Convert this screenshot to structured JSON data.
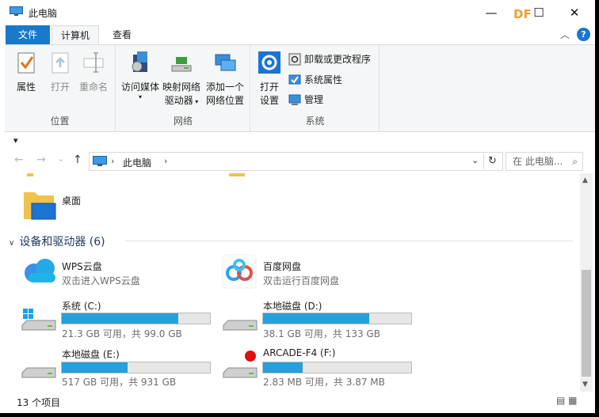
{
  "window": {
    "title": "此电脑",
    "minimize": "—",
    "maximize": "☐",
    "close": "✕",
    "watermark": "DF"
  },
  "ribbon_tabs": {
    "file": "文件",
    "computer": "计算机",
    "view": "查看",
    "collapse": "︿",
    "help": "?"
  },
  "ribbon": {
    "location": {
      "label": "位置",
      "properties": "属性",
      "open": "打开",
      "rename": "重命名"
    },
    "network": {
      "label": "网络",
      "access_media": "访问媒体",
      "map_drive_1": "映射网络",
      "map_drive_2": "驱动器",
      "add_location_1": "添加一个",
      "add_location_2": "网络位置"
    },
    "system": {
      "label": "系统",
      "open_settings_1": "打开",
      "open_settings_2": "设置",
      "uninstall": "卸载或更改程序",
      "system_properties": "系统属性",
      "manage": "管理"
    }
  },
  "qat": {
    "arrow": "▾"
  },
  "nav": {
    "back": "←",
    "forward": "→",
    "recent": "⌄",
    "up": "↑",
    "breadcrumb": "此电脑",
    "sep": "›",
    "dropdown": "⌄",
    "refresh": "↻",
    "search_placeholder": "在 此电脑...",
    "search_icon": "⌕"
  },
  "folders": [
    {
      "name": "桌面"
    }
  ],
  "section": {
    "title": "设备和驱动器 (6)",
    "chevron": "∨"
  },
  "apps": [
    {
      "name": "WPS云盘",
      "sub": "双击进入WPS云盘"
    },
    {
      "name": "百度网盘",
      "sub": "双击运行百度网盘"
    }
  ],
  "drives": [
    {
      "name": "系统 (C:)",
      "usage": "21.3 GB 可用，共 99.0 GB",
      "used_fraction": 0.785,
      "icon": "windows-drive-icon"
    },
    {
      "name": "本地磁盘 (D:)",
      "usage": "38.1 GB 可用，共 133 GB",
      "used_fraction": 0.714,
      "icon": "hard-drive-icon"
    },
    {
      "name": "本地磁盘 (E:)",
      "usage": "517 GB 可用，共 931 GB",
      "used_fraction": 0.445,
      "icon": "hard-drive-icon"
    },
    {
      "name": "ARCADE-F4 (F:)",
      "usage": "2.83 MB 可用，共 3.87 MB",
      "used_fraction": 0.27,
      "icon": "removable-drive-icon"
    }
  ],
  "status": {
    "count": "13 个项目",
    "views": "▤ ▦"
  },
  "colors": {
    "accent": "#1979ca",
    "bar_fill": "#26a0da",
    "ribbon_bg": "#f5f6f7"
  }
}
